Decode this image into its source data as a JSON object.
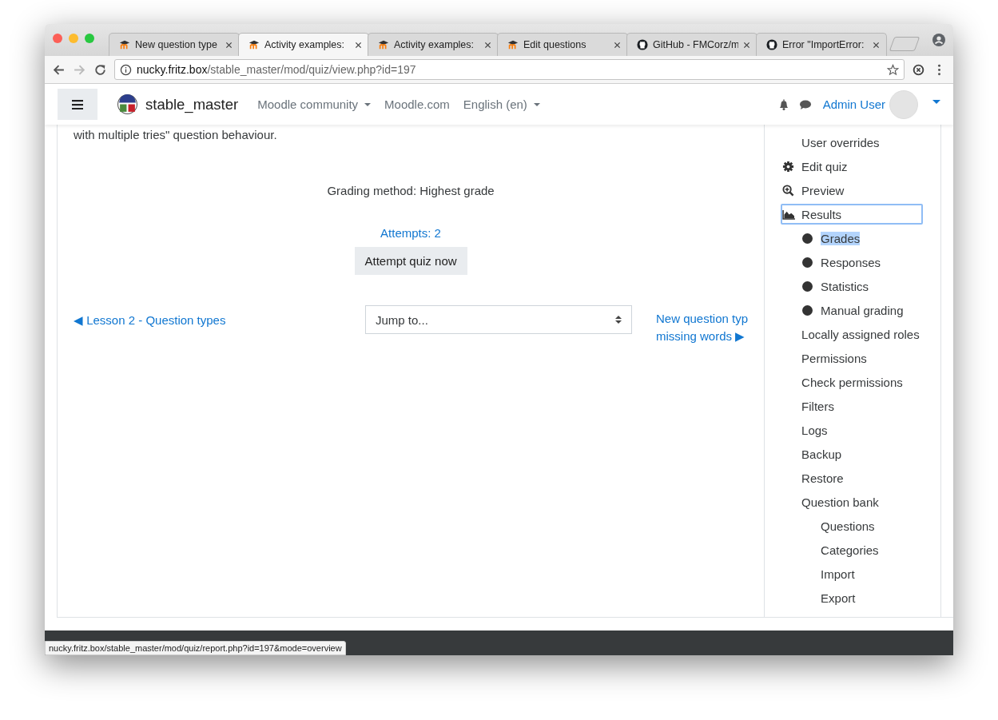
{
  "browser": {
    "tabs": [
      {
        "title": "New question type",
        "selected": false,
        "kind": "moodle"
      },
      {
        "title": "Activity examples:",
        "selected": true,
        "kind": "moodle"
      },
      {
        "title": "Activity examples:",
        "selected": false,
        "kind": "moodle"
      },
      {
        "title": "Edit questions",
        "selected": false,
        "kind": "moodle"
      },
      {
        "title": "GitHub - FMCorz/m",
        "selected": false,
        "kind": "github"
      },
      {
        "title": "Error \"ImportError:",
        "selected": false,
        "kind": "github"
      }
    ],
    "url_host": "nucky.fritz.box",
    "url_path": "/stable_master/mod/quiz/view.php?id=197"
  },
  "navbar": {
    "site_name": "stable_master",
    "menus": [
      {
        "label": "Moodle community",
        "dropdown": true
      },
      {
        "label": "Moodle.com",
        "dropdown": false
      },
      {
        "label": "English (en)",
        "dropdown": true
      }
    ],
    "user_name": "Admin User"
  },
  "main": {
    "intro_tail": "with multiple tries\" question behaviour.",
    "grading_method": "Grading method: Highest grade",
    "attempts_link": "Attempts: 2",
    "attempt_button": "Attempt quiz now",
    "prev_link": "◀ Lesson 2 - Question types",
    "jump_placeholder": "Jump to...",
    "next_link_lines": [
      "New question typ",
      "missing words ▶"
    ]
  },
  "admin_menu": [
    {
      "label": "User overrides",
      "kind": "plain",
      "focused": false
    },
    {
      "label": "Edit quiz",
      "kind": "settings",
      "focused": false
    },
    {
      "label": "Preview",
      "kind": "preview",
      "focused": false
    },
    {
      "label": "Results",
      "kind": "report",
      "focused": true,
      "children": [
        {
          "label": "Grades",
          "kind": "bullet",
          "highlighted": true
        },
        {
          "label": "Responses",
          "kind": "bullet",
          "highlighted": false
        },
        {
          "label": "Statistics",
          "kind": "bullet",
          "highlighted": false
        },
        {
          "label": "Manual grading",
          "kind": "bullet",
          "highlighted": false
        }
      ]
    },
    {
      "label": "Locally assigned roles",
      "kind": "plain",
      "focused": false
    },
    {
      "label": "Permissions",
      "kind": "plain",
      "focused": false
    },
    {
      "label": "Check permissions",
      "kind": "plain",
      "focused": false
    },
    {
      "label": "Filters",
      "kind": "plain",
      "focused": false
    },
    {
      "label": "Logs",
      "kind": "plain",
      "focused": false
    },
    {
      "label": "Backup",
      "kind": "plain",
      "focused": false
    },
    {
      "label": "Restore",
      "kind": "plain",
      "focused": false
    },
    {
      "label": "Question bank",
      "kind": "plain",
      "focused": false,
      "children": [
        {
          "label": "Questions",
          "kind": "plain",
          "highlighted": false
        },
        {
          "label": "Categories",
          "kind": "plain",
          "highlighted": false
        },
        {
          "label": "Import",
          "kind": "plain",
          "highlighted": false
        },
        {
          "label": "Export",
          "kind": "plain",
          "highlighted": false
        }
      ]
    }
  ],
  "status_url": "nucky.fritz.box/stable_master/mod/quiz/report.php?id=197&mode=overview"
}
